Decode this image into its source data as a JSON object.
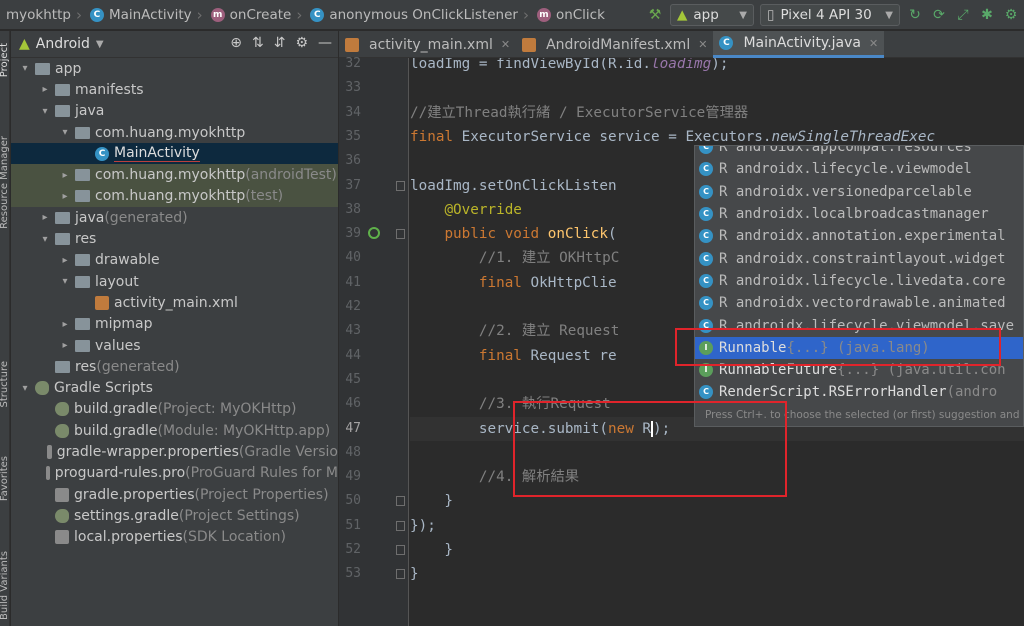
{
  "breadcrumb": [
    {
      "label": "myokhttp",
      "icon": "folder-icon"
    },
    {
      "label": "MainActivity",
      "icon": "class-icon"
    },
    {
      "label": "onCreate",
      "icon": "method-icon"
    },
    {
      "label": "anonymous OnClickListener",
      "icon": "class-icon"
    },
    {
      "label": "onClick",
      "icon": "method-icon"
    }
  ],
  "toolbar": {
    "config": "app",
    "device": "Pixel 4 API 30"
  },
  "side_labels": {
    "project": "Project",
    "resource_manager": "Resource Manager",
    "structure": "Structure",
    "favorites": "Favorites",
    "build_variants": "Build Variants"
  },
  "project_panel": {
    "view_selector": "Android",
    "tree": [
      {
        "label": "app",
        "suffix": "",
        "depth": 0,
        "arrow": "▾",
        "icon": "folder"
      },
      {
        "label": "manifests",
        "suffix": "",
        "depth": 1,
        "arrow": "▸",
        "icon": "folder"
      },
      {
        "label": "java",
        "suffix": "",
        "depth": 1,
        "arrow": "▾",
        "icon": "folder"
      },
      {
        "label": "com.huang.myokhttp",
        "suffix": "",
        "depth": 2,
        "arrow": "▾",
        "icon": "folder"
      },
      {
        "label": "MainActivity",
        "suffix": "",
        "depth": 3,
        "arrow": "",
        "icon": "class",
        "selected": true
      },
      {
        "label": "com.huang.myokhttp",
        "suffix": " (androidTest)",
        "depth": 2,
        "arrow": "▸",
        "icon": "folder",
        "green": true
      },
      {
        "label": "com.huang.myokhttp",
        "suffix": " (test)",
        "depth": 2,
        "arrow": "▸",
        "icon": "folder",
        "green": true
      },
      {
        "label": "java",
        "suffix": " (generated)",
        "depth": 1,
        "arrow": "▸",
        "icon": "folder"
      },
      {
        "label": "res",
        "suffix": "",
        "depth": 1,
        "arrow": "▾",
        "icon": "folder"
      },
      {
        "label": "drawable",
        "suffix": "",
        "depth": 2,
        "arrow": "▸",
        "icon": "folder"
      },
      {
        "label": "layout",
        "suffix": "",
        "depth": 2,
        "arrow": "▾",
        "icon": "folder"
      },
      {
        "label": "activity_main.xml",
        "suffix": "",
        "depth": 3,
        "arrow": "",
        "icon": "xml"
      },
      {
        "label": "mipmap",
        "suffix": "",
        "depth": 2,
        "arrow": "▸",
        "icon": "folder"
      },
      {
        "label": "values",
        "suffix": "",
        "depth": 2,
        "arrow": "▸",
        "icon": "folder"
      },
      {
        "label": "res",
        "suffix": " (generated)",
        "depth": 1,
        "arrow": "",
        "icon": "folder"
      },
      {
        "label": "Gradle Scripts",
        "suffix": "",
        "depth": 0,
        "arrow": "▾",
        "icon": "gradle"
      },
      {
        "label": "build.gradle",
        "suffix": " (Project: MyOKHttp)",
        "depth": 1,
        "arrow": "",
        "icon": "gradle"
      },
      {
        "label": "build.gradle",
        "suffix": " (Module: MyOKHttp.app)",
        "depth": 1,
        "arrow": "",
        "icon": "gradle"
      },
      {
        "label": "gradle-wrapper.properties",
        "suffix": " (Gradle Versio",
        "depth": 1,
        "arrow": "",
        "icon": "props"
      },
      {
        "label": "proguard-rules.pro",
        "suffix": " (ProGuard Rules for M",
        "depth": 1,
        "arrow": "",
        "icon": "props"
      },
      {
        "label": "gradle.properties",
        "suffix": " (Project Properties)",
        "depth": 1,
        "arrow": "",
        "icon": "props"
      },
      {
        "label": "settings.gradle",
        "suffix": " (Project Settings)",
        "depth": 1,
        "arrow": "",
        "icon": "gradle"
      },
      {
        "label": "local.properties",
        "suffix": " (SDK Location)",
        "depth": 1,
        "arrow": "",
        "icon": "props"
      }
    ]
  },
  "editor_tabs": [
    {
      "label": "activity_main.xml",
      "active": false
    },
    {
      "label": "AndroidManifest.xml",
      "active": false
    },
    {
      "label": "MainActivity.java",
      "active": true
    }
  ],
  "line_numbers": [
    "32",
    "33",
    "34",
    "35",
    "36",
    "37",
    "38",
    "39",
    "40",
    "41",
    "42",
    "43",
    "44",
    "45",
    "46",
    "47",
    "48",
    "49",
    "50",
    "51",
    "52",
    "53"
  ],
  "code_lines": [
    {
      "n": "32",
      "html": "        loadImg = findViewById(R.id.<i class='fld'>loadimg</i>);"
    },
    {
      "n": "33",
      "html": ""
    },
    {
      "n": "34",
      "html": "        <span class='cmt'>//建立Thread執行緒 / ExecutorService管理器</span>"
    },
    {
      "n": "35",
      "html": "        <span class='kw'>final</span> ExecutorService service = Executors.<i>newSingleThreadExec</i>"
    },
    {
      "n": "36",
      "html": ""
    },
    {
      "n": "37",
      "html": "        loadImg.setOnClickListen"
    },
    {
      "n": "38",
      "html": "            <span class='ann'>@Override</span>"
    },
    {
      "n": "39",
      "html": "            <span class='kw'>public void</span> <span class='fn'>onClick</span>("
    },
    {
      "n": "40",
      "html": "                <span class='cmt'>//1. 建立 OKHttpC</span>"
    },
    {
      "n": "41",
      "html": "                <span class='kw'>final</span> OkHttpClie"
    },
    {
      "n": "42",
      "html": ""
    },
    {
      "n": "43",
      "html": "                <span class='cmt'>//2. 建立 Request</span>"
    },
    {
      "n": "44",
      "html": "                <span class='kw'>final</span> Request re"
    },
    {
      "n": "45",
      "html": ""
    },
    {
      "n": "46",
      "html": "                <span class='cmt'>//3. 執行Request</span>"
    },
    {
      "n": "47",
      "html": "                service.submit(<span class='kw'>new</span> R<span class='caret'></span>);"
    },
    {
      "n": "48",
      "html": ""
    },
    {
      "n": "49",
      "html": "                <span class='cmt'>//4. 解析結果</span>"
    },
    {
      "n": "50",
      "html": "            }"
    },
    {
      "n": "51",
      "html": "        });"
    },
    {
      "n": "52",
      "html": "    }"
    },
    {
      "n": "53",
      "html": "}"
    }
  ],
  "autocomplete": {
    "items": [
      {
        "text": "R  androidx.appcompat.resources",
        "dim": false,
        "icon": "class"
      },
      {
        "text": "R  androidx.lifecycle.viewmodel",
        "dim": false,
        "icon": "class"
      },
      {
        "text": "R  androidx.versionedparcelable",
        "dim": false,
        "icon": "class"
      },
      {
        "text": "R  androidx.localbroadcastmanager",
        "dim": false,
        "icon": "class"
      },
      {
        "text": "R  androidx.annotation.experimental",
        "dim": false,
        "icon": "class"
      },
      {
        "text": "R  androidx.constraintlayout.widget",
        "dim": false,
        "icon": "class"
      },
      {
        "text": "R  androidx.lifecycle.livedata.core",
        "dim": false,
        "icon": "class"
      },
      {
        "text": "R  androidx.vectordrawable.animated",
        "dim": false,
        "icon": "class"
      },
      {
        "text": "R  androidx.lifecycle.viewmodel.save",
        "dim": false,
        "icon": "class"
      },
      {
        "name": "Runnable",
        "extra": "{...} (java.lang)",
        "icon": "interface",
        "selected": true
      },
      {
        "name": "RunnableFuture",
        "extra": "{...} (java.util.con",
        "icon": "interface"
      },
      {
        "name": "RenderScript.RSErrorHandler",
        "extra": " (andro",
        "icon": "class"
      }
    ],
    "hint": "Press Ctrl+. to choose the selected (or first) suggestion and inse"
  }
}
